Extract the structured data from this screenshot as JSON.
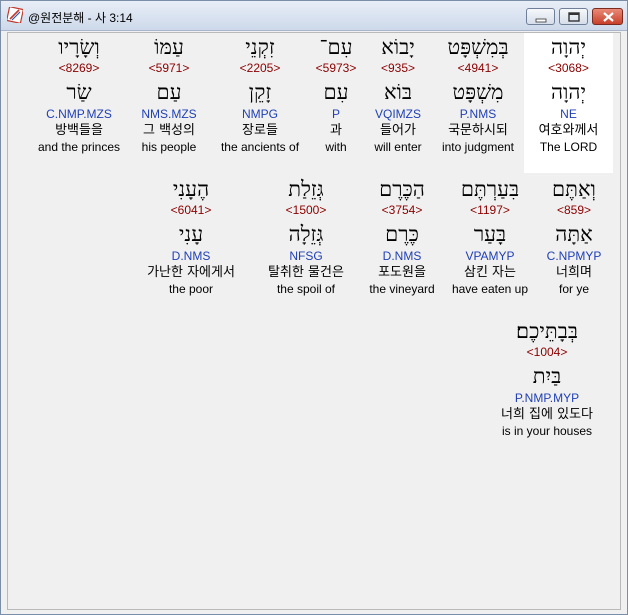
{
  "window": {
    "title": "@원전분해 - 사 3:14"
  },
  "words": [
    {
      "hebrew": "יְהוָה",
      "strong": "<3068>",
      "root": "יְהוָה",
      "parse": "NE",
      "korean": "여호와께서",
      "english": "The LORD"
    },
    {
      "hebrew": "בְּמִשְׁפָּט",
      "strong": "<4941>",
      "root": "מִשְׁפָּט",
      "parse": "P.NMS",
      "korean": "국문하시되",
      "english": "into judgment"
    },
    {
      "hebrew": "יָבוֹא",
      "strong": "<935>",
      "root": "בּוֹא",
      "parse": "VQIMZS",
      "korean": "들어가",
      "english": "will enter"
    },
    {
      "hebrew": "עִם־",
      "strong": "<5973>",
      "root": "עִם",
      "parse": "P",
      "korean": "과",
      "english": "with"
    },
    {
      "hebrew": "זִקְנֵי",
      "strong": "<2205>",
      "root": "זָקֵן",
      "parse": "NMPG",
      "korean": "장로들",
      "english": "the ancients of"
    },
    {
      "hebrew": "עַמּוֹ",
      "strong": "<5971>",
      "root": "עַם",
      "parse": "NMS.MZS",
      "korean": "그 백성의",
      "english": "his people"
    },
    {
      "hebrew": "וְשָׂרָיו",
      "strong": "<8269>",
      "root": "שַׂר",
      "parse": "C.NMP.MZS",
      "korean": "방백들을",
      "english": "and the princes"
    },
    {
      "hebrew": "וְאַתֶּם",
      "strong": "<859>",
      "root": "אַתָּה",
      "parse": "C.NPMYP",
      "korean": "너희며",
      "english": "for ye"
    },
    {
      "hebrew": "בִּעַרְתֶּם",
      "strong": "<1197>",
      "root": "בָּעַר",
      "parse": "VPAMYP",
      "korean": "삼킨 자는",
      "english": "have eaten up"
    },
    {
      "hebrew": "הַכֶּרֶם",
      "strong": "<3754>",
      "root": "כֶּרֶם",
      "parse": "D.NMS",
      "korean": "포도원을",
      "english": "the vineyard"
    },
    {
      "hebrew": "גְּזֵלַת",
      "strong": "<1500>",
      "root": "גְּזֵלָה",
      "parse": "NFSG",
      "korean": "탈취한 물건은",
      "english": "the spoil of"
    },
    {
      "hebrew": "הֶעָנִי",
      "strong": "<6041>",
      "root": "עָנִי",
      "parse": "D.NMS",
      "korean": "가난한 자에게서",
      "english": "the poor"
    },
    {
      "hebrew": "בְּבָתֵּיכֶם׃",
      "strong": "<1004>",
      "root": "בַּיִת",
      "parse": "P.NMP.MYP",
      "korean": "너희 집에 있도다",
      "english": "is in your houses"
    }
  ]
}
